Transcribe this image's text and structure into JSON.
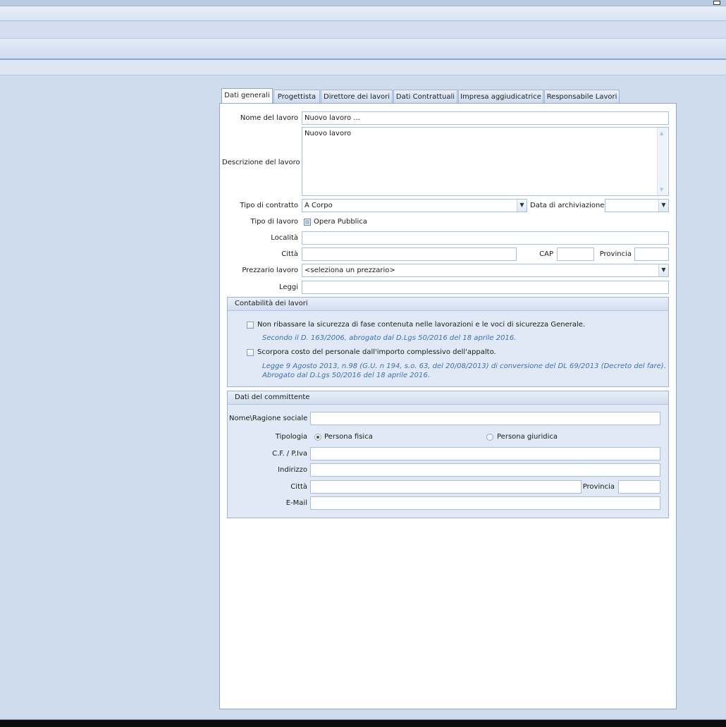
{
  "tabs": [
    "Dati generali",
    "Progettista",
    "Direttore dei lavori",
    "Dati Contrattuali",
    "Impresa aggiudicatrice",
    "Responsabile Lavori"
  ],
  "form": {
    "nome_label": "Nome del lavoro",
    "nome_value": "Nuovo lavoro ...",
    "descrizione_label": "Descrizione del lavoro",
    "descrizione_value": "Nuovo lavoro",
    "tipo_contratto_label": "Tipo di contratto",
    "tipo_contratto_value": "A Corpo",
    "data_archiviazione_label": "Data di archiviazione",
    "data_archiviazione_value": "",
    "tipo_lavoro_label": "Tipo di lavoro",
    "opera_pubblica_label": "Opera Pubblica",
    "localita_label": "Località",
    "localita_value": "",
    "citta_label": "Città",
    "citta_value": "",
    "cap_label": "CAP",
    "cap_value": "",
    "provincia_label": "Provincia",
    "provincia_value": "",
    "prezzario_label": "Prezzario lavoro",
    "prezzario_value": "<seleziona un prezzario>",
    "leggi_label": "Leggi",
    "leggi_value": ""
  },
  "contabilita": {
    "title": "Contabilità dei lavori",
    "opt1_label": "Non ribassare la sicurezza di fase contenuta nelle lavorazioni e le voci di sicurezza Generale.",
    "opt1_note": "Secondo il D. 163/2006, abrogato dal D.Lgs 50/2016 del 18 aprile 2016.",
    "opt2_label": "Scorpora costo del personale dall'importo complessivo dell'appalto.",
    "opt2_note_line1": "Legge 9 Agosto 2013, n.98 (G.U. n 194, s.o. 63, del 20/08/2013) di conversione del DL 69/2013 (Decreto del fare).",
    "opt2_note_line2": "Abrogato dal D.Lgs 50/2016 del 18 aprile 2016."
  },
  "committente": {
    "title": "Dati del committente",
    "nome_label": "Nome\\Ragione sociale",
    "nome_value": "",
    "tipologia_label": "Tipologia",
    "persona_fisica_label": "Persona fisica",
    "persona_giuridica_label": "Persona giuridica",
    "selected_tipologia": "Persona fisica",
    "cf_label": "C.F. / P.Iva",
    "cf_value": "",
    "indirizzo_label": "Indirizzo",
    "indirizzo_value": "",
    "citta_label": "Città",
    "citta_value": "",
    "provincia_label": "Provincia",
    "provincia_value": "",
    "email_label": "E-Mail",
    "email_value": ""
  },
  "icons": [
    "restore-icon",
    "dropdown-arrow-icon",
    "scroll-up-icon",
    "scroll-down-icon"
  ]
}
